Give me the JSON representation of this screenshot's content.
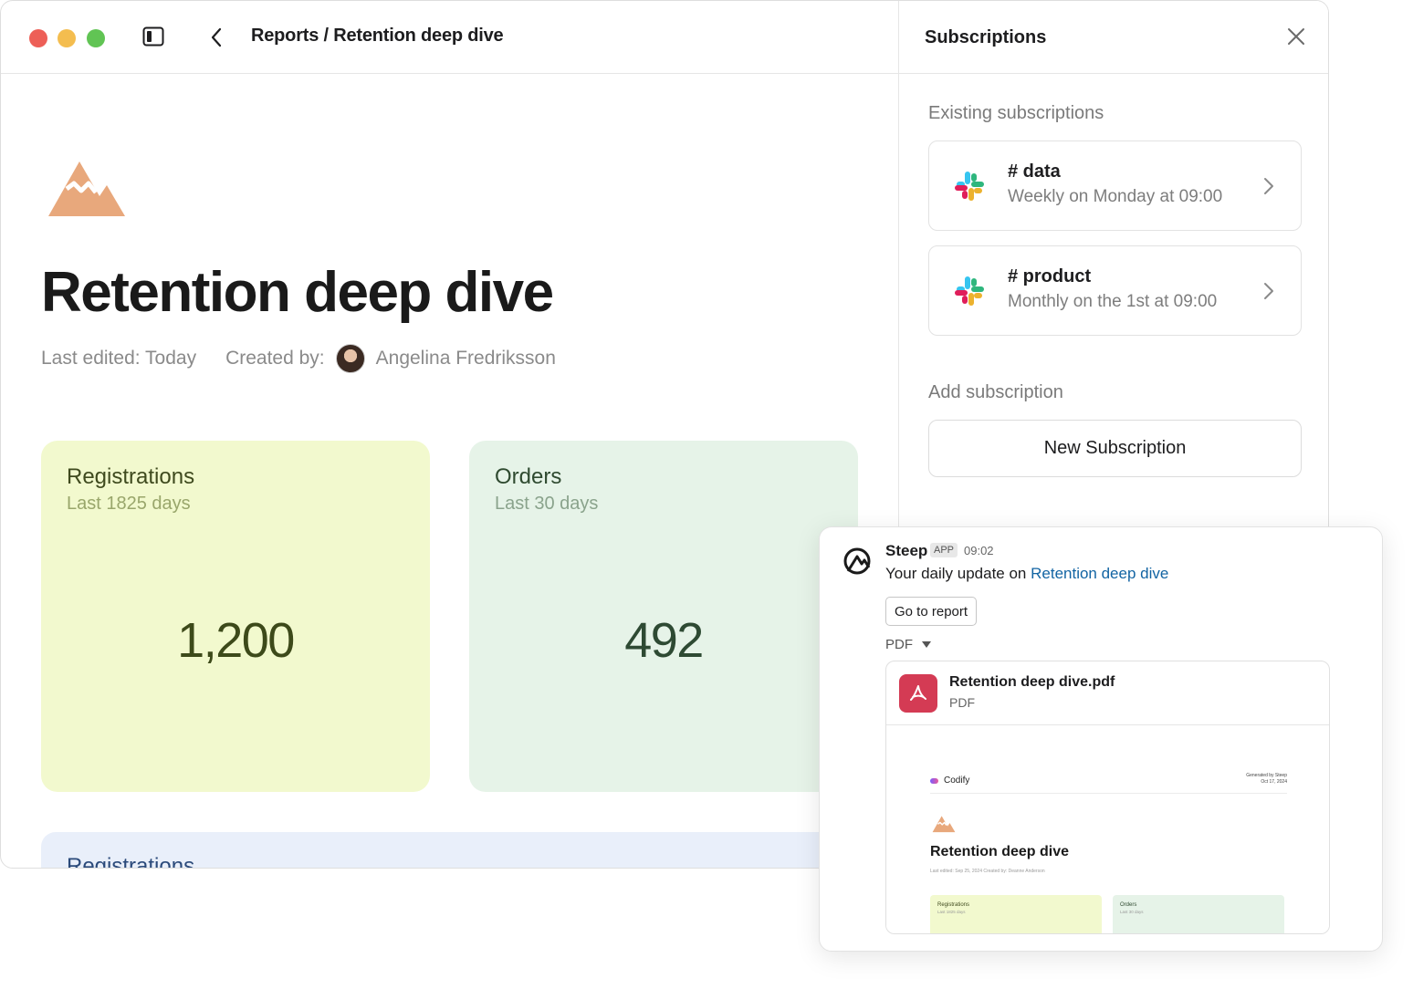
{
  "header": {
    "breadcrumb": "Reports / Retention deep dive"
  },
  "report": {
    "title": "Retention deep dive",
    "last_edited": "Last edited: Today",
    "created_by_label": "Created by:",
    "author": "Angelina Fredriksson"
  },
  "cards": [
    {
      "title": "Registrations",
      "subtitle": "Last 1825 days",
      "value": "1,200"
    },
    {
      "title": "Orders",
      "subtitle": "Last 30 days",
      "value": "492"
    }
  ],
  "section_next": {
    "title": "Registrations"
  },
  "subscriptions_panel": {
    "title": "Subscriptions",
    "existing_label": "Existing subscriptions",
    "items": [
      {
        "channel": "# data",
        "schedule": "Weekly on Monday at 09:00",
        "icon": "slack-icon"
      },
      {
        "channel": "# product",
        "schedule": "Monthly on the 1st at 09:00",
        "icon": "slack-icon"
      }
    ],
    "add_label": "Add subscription",
    "new_button": "New Subscription"
  },
  "message": {
    "sender": "Steep",
    "badge": "APP",
    "time": "09:02",
    "text_prefix": "Your daily update on ",
    "link_text": "Retention deep dive",
    "button": "Go to report",
    "attachment_toggle": "PDF",
    "file": {
      "name": "Retention deep dive.pdf",
      "type": "PDF"
    },
    "preview": {
      "brand": "Codify",
      "generated_line1": "Generated by Steep",
      "generated_line2": "Oct 17, 2024",
      "title": "Retention deep dive",
      "meta": "Last edited: Sep 25, 2024     Created by:     Deanne Anderson",
      "cards": [
        {
          "title": "Registrations",
          "subtitle": "Last 1825 days"
        },
        {
          "title": "Orders",
          "subtitle": "Last 30 days"
        }
      ]
    }
  },
  "colors": {
    "registrations_bg": "#f2f9ce",
    "orders_bg": "#e6f3e8",
    "report_icon": "#e8a87c",
    "link": "#1264a3",
    "pdf_icon": "#d43b54"
  }
}
